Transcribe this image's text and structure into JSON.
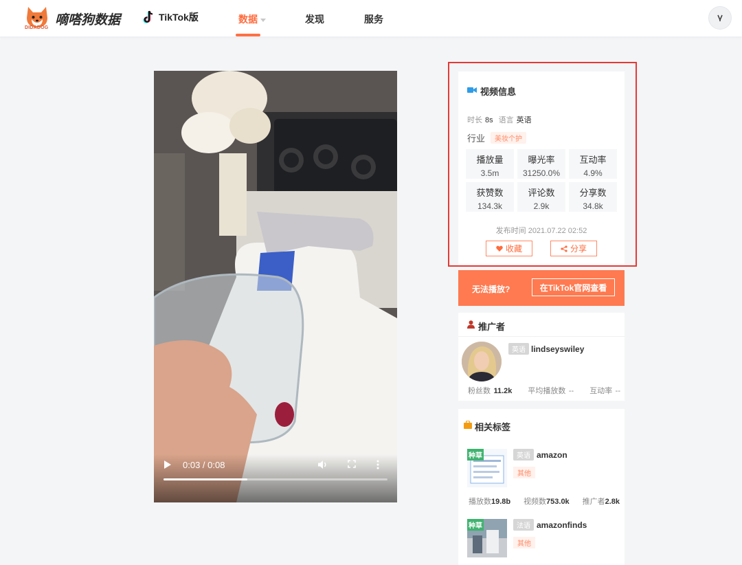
{
  "header": {
    "logo_text": "DIDADOG",
    "brand": "嘀嗒狗数据",
    "tiktok_label": "TikTok版",
    "nav": [
      {
        "label": "数据",
        "active": true
      },
      {
        "label": "发现",
        "active": false
      },
      {
        "label": "服务",
        "active": false
      }
    ]
  },
  "video": {
    "time": "0:03 / 0:08",
    "progress": 0.375
  },
  "info": {
    "title": "视频信息",
    "duration_label": "时长",
    "duration_value": "8s",
    "language_label": "语言",
    "language_value": "英语",
    "industry_label": "行业",
    "industry_value": "美妆个护",
    "stats": [
      {
        "label": "播放量",
        "value": "3.5m"
      },
      {
        "label": "曝光率",
        "value": "31250.0%"
      },
      {
        "label": "互动率",
        "value": "4.9%"
      },
      {
        "label": "获赞数",
        "value": "134.3k"
      },
      {
        "label": "评论数",
        "value": "2.9k"
      },
      {
        "label": "分享数",
        "value": "34.8k"
      }
    ],
    "publish": "发布时间 2021.07.22 02:52",
    "favorite_label": "收藏",
    "share_label": "分享"
  },
  "cta": {
    "text": "无法播放?",
    "button": "在TikTok官网查看"
  },
  "promoter": {
    "title": "推广者",
    "lang_badge": "英语",
    "handle": "lindseyswiley",
    "fans_label": "粉丝数",
    "fans_value": "11.2k",
    "avg_play_label": "平均播放数",
    "avg_play_value": "--",
    "interaction_label": "互动率",
    "interaction_value": "--"
  },
  "tags": {
    "title": "相关标签",
    "items": [
      {
        "badge": "种草",
        "lang": "英语",
        "name": "amazon",
        "category": "其他",
        "play_label": "播放数",
        "play_value": "19.8b",
        "video_label": "视频数",
        "video_value": "753.0k",
        "promoter_label": "推广者",
        "promoter_value": "2.8k"
      },
      {
        "badge": "种草",
        "lang": "法语",
        "name": "amazonfinds",
        "category": "其他"
      }
    ]
  },
  "colors": {
    "accent": "#ff6b3d",
    "cta_bg": "#ff7a50",
    "highlight_border": "#e53935"
  }
}
